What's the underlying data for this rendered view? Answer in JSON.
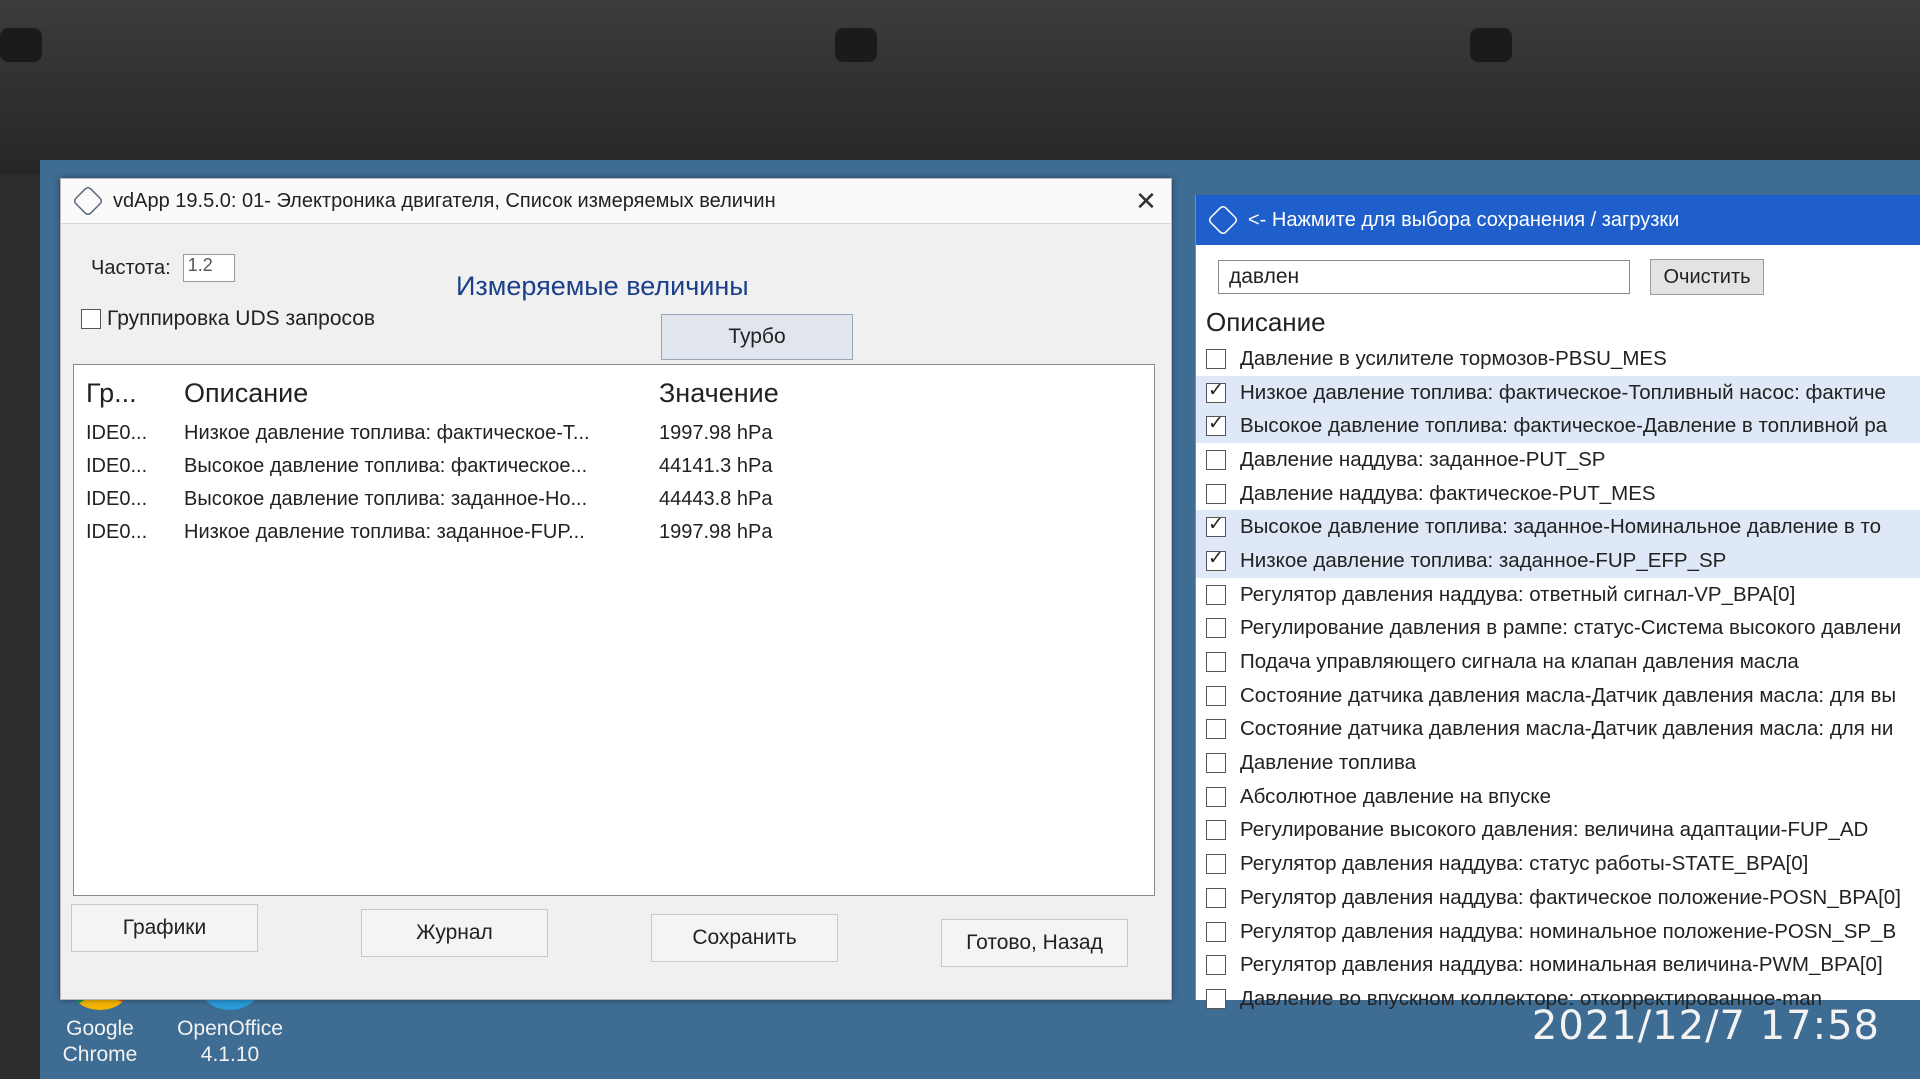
{
  "left_window": {
    "title": "vdApp 19.5.0: 01- Электроника двигателя,  Список измеряемых величин",
    "close_glyph": "✕",
    "freq_label": "Частота:",
    "freq_value": "1.2",
    "section_title": "Измеряемые величины",
    "uds_grouping_label": "Группировка UDS запросов",
    "uds_grouping_checked": false,
    "turbo_label": "Турбо",
    "table": {
      "columns": [
        "Гр...",
        "Описание",
        "Значение"
      ],
      "rows": [
        {
          "group": "IDE0...",
          "description": "Низкое давление топлива: фактическое-Т...",
          "value": "1997.98 hPa"
        },
        {
          "group": "IDE0...",
          "description": "Высокое давление топлива: фактическое...",
          "value": "44141.3 hPa"
        },
        {
          "group": "IDE0...",
          "description": "Высокое давление топлива: заданное-Но...",
          "value": "44443.8 hPa"
        },
        {
          "group": "IDE0...",
          "description": "Низкое давление топлива: заданное-FUP...",
          "value": "1997.98 hPa"
        }
      ]
    },
    "buttons": {
      "graphs": "Графики",
      "journal": "Журнал",
      "save": "Сохранить",
      "done_back": "Готово, Назад"
    }
  },
  "right_panel": {
    "title": "<- Нажмите для выбора сохранения / загрузки",
    "search_value": "давлен",
    "clear_label": "Очистить",
    "list_header": "Описание",
    "items": [
      {
        "label": "Давление в усилителе тормозов-PBSU_MES",
        "checked": false
      },
      {
        "label": "Низкое давление топлива: фактическое-Топливный насос: фактиче",
        "checked": true
      },
      {
        "label": "Высокое давление топлива: фактическое-Давление в топливной ра",
        "checked": true
      },
      {
        "label": "Давление наддува: заданное-PUT_SP",
        "checked": false
      },
      {
        "label": "Давление наддува: фактическое-PUT_MES",
        "checked": false
      },
      {
        "label": "Высокое давление топлива: заданное-Номинальное давление в то",
        "checked": true
      },
      {
        "label": "Низкое давление топлива: заданное-FUP_EFP_SP",
        "checked": true
      },
      {
        "label": "Регулятор давления наддува: ответный сигнал-VP_BPA[0]",
        "checked": false
      },
      {
        "label": "Регулирование давления в рампе: статус-Система высокого давлени",
        "checked": false
      },
      {
        "label": "Подача управляющего сигнала на клапан давления масла",
        "checked": false
      },
      {
        "label": "Состояние датчика давления масла-Датчик давления масла: для вы",
        "checked": false
      },
      {
        "label": "Состояние датчика давления масла-Датчик давления масла: для ни",
        "checked": false
      },
      {
        "label": "Давление топлива",
        "checked": false
      },
      {
        "label": "Абсолютное давление на впуске",
        "checked": false
      },
      {
        "label": "Регулирование высокого давления: величина адаптации-FUP_AD",
        "checked": false
      },
      {
        "label": "Регулятор давления наддува: статус работы-STATE_BPA[0]",
        "checked": false
      },
      {
        "label": "Регулятор давления наддува: фактическое положение-POSN_BPA[0]",
        "checked": false
      },
      {
        "label": "Регулятор давления наддува: номинальное положение-POSN_SP_B",
        "checked": false
      },
      {
        "label": "Регулятор давления наддува: номинальная величина-PWM_BPA[0]",
        "checked": false
      },
      {
        "label": "Давление во впускном коллекторе: откорректированное-man",
        "checked": false
      }
    ]
  },
  "desktop": {
    "icons": [
      {
        "label_line1": "Google",
        "label_line2": "Chrome",
        "icon": "chrome-icon"
      },
      {
        "label_line1": "OpenOffice",
        "label_line2": "4.1.10",
        "icon": "openoffice-icon"
      }
    ],
    "timestamp": "2021/12/7  17:58"
  },
  "colors": {
    "title_accent": "#1b3f8a",
    "right_title_bg": "#1f5fcb",
    "desktop_bg": "#3f6c93"
  }
}
